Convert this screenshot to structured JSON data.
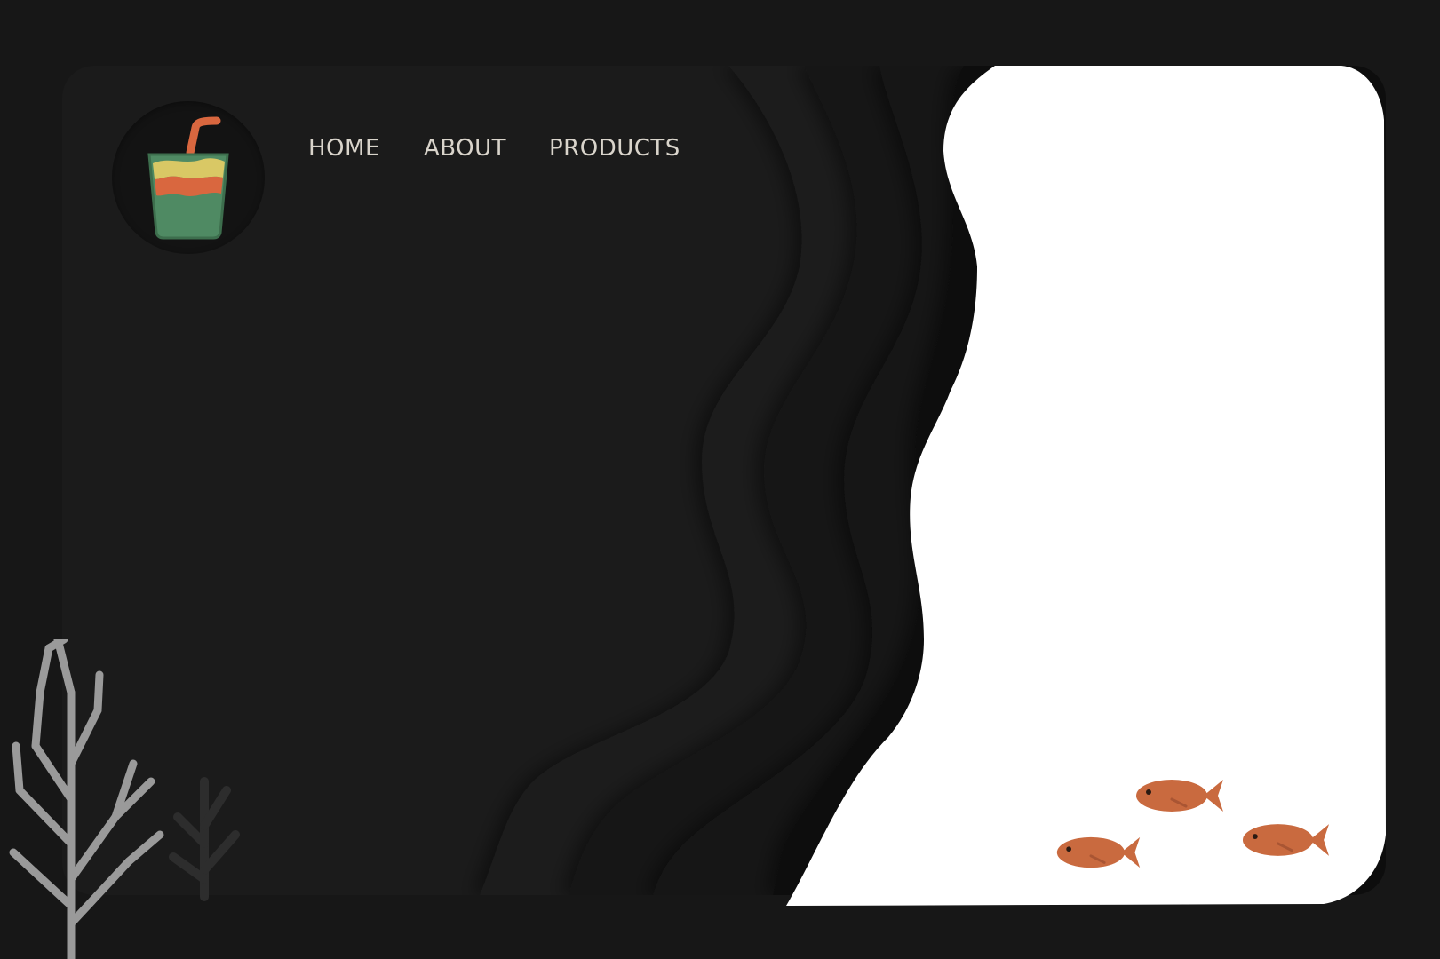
{
  "brand": {
    "logo_icon": "drink-cup-icon",
    "colors": {
      "cup_green": "#4f8a63",
      "cup_orange": "#d9673f",
      "cup_yellow": "#d9c865",
      "straw": "#d9673f"
    }
  },
  "nav": {
    "items": [
      {
        "label": "HOME"
      },
      {
        "label": "ABOUT"
      },
      {
        "label": "PRODUCTS"
      }
    ]
  },
  "hero": {
    "background": "#1b1b1b",
    "panel_color": "#ffffff",
    "accent": "#c96a3f",
    "fish_count": 3,
    "plant_icon": "seaweed-icon",
    "fish_icon": "fish-icon"
  }
}
